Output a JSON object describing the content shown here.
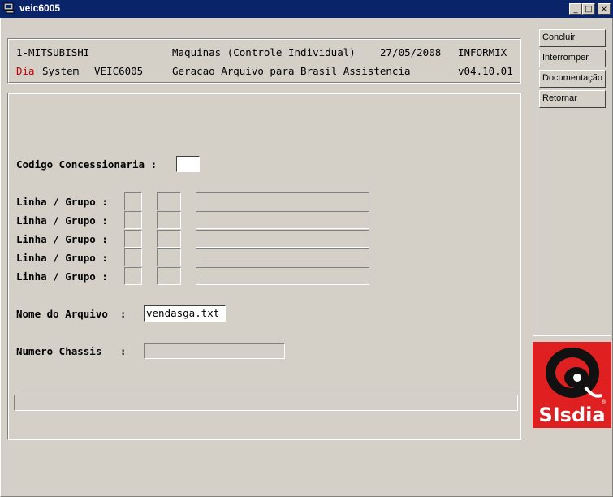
{
  "window": {
    "title": "veic6005",
    "controls": {
      "minimize": "_",
      "maximize": "□",
      "close": "×"
    }
  },
  "header": {
    "company": "1-MITSUBISHI",
    "module": "Maquinas (Controle Individual)",
    "date": "27/05/2008",
    "db": "INFORMIX",
    "brand_red": "Dia",
    "brand_rest": "System",
    "program": "VEIC6005",
    "description": "Geracao Arquivo para Brasil Assistencia",
    "version": "v04.10.01"
  },
  "form": {
    "codigo_label": "Codigo Concessionaria :",
    "codigo_value": "",
    "linha_label": "Linha / Grupo :",
    "linha_rows": 5,
    "arquivo_label": "Nome do Arquivo  :",
    "arquivo_value": "vendasga.txt",
    "chassis_label": "Numero Chassis   :",
    "chassis_value": ""
  },
  "sidebar": {
    "buttons": [
      "Concluir",
      "Interromper",
      "Documentação",
      "Retornar"
    ]
  },
  "logo": {
    "text": "SIsdia",
    "mark": "®",
    "color": "#e02020"
  }
}
